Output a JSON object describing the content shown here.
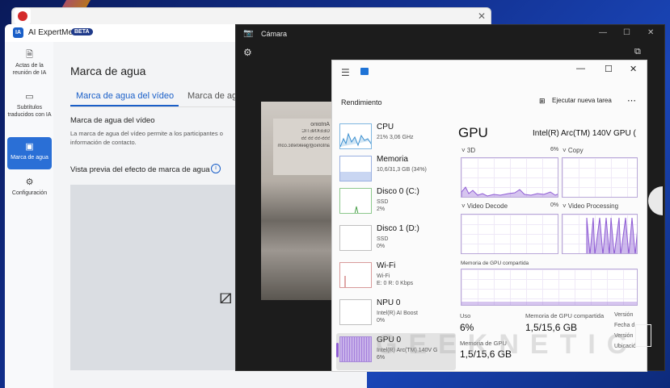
{
  "ai_expertmeet": {
    "app_name": "AI ExpertMeet",
    "badge": "BETA",
    "sidebar": [
      {
        "label": "Actas de la reunión de IA"
      },
      {
        "label": "Subtítulos traducidos con IA"
      },
      {
        "label": "Marca de agua"
      },
      {
        "label": "Configuración"
      }
    ],
    "page_title": "Marca de agua",
    "tabs": [
      "Marca de agua del vídeo",
      "Marca de ag"
    ],
    "section_title": "Marca de agua del vídeo",
    "section_desc": "La marca de agua del vídeo permite a los participantes o información de contacto.",
    "preview_title": "Vista previa del efecto de marca de agua",
    "info_icon": "i"
  },
  "camera": {
    "title": "Cámara",
    "card_lines": [
      "Antoino",
      "GEEKNETIC",
      "555-55 55 55",
      "antonio@geeknetic.com"
    ]
  },
  "taskmgr": {
    "section": "Rendimiento",
    "run_task": "Ejecutar nueva tarea",
    "items": [
      {
        "name": "CPU",
        "sub": "21%  3,06 GHz"
      },
      {
        "name": "Memoria",
        "sub": "10,6/31,3 GB (34%)"
      },
      {
        "name": "Disco 0 (C:)",
        "sub": "SSD\n2%"
      },
      {
        "name": "Disco 1 (D:)",
        "sub": "SSD\n0%"
      },
      {
        "name": "Wi-Fi",
        "sub": "Wi-Fi\nE: 0 R: 0 Kbps"
      },
      {
        "name": "NPU 0",
        "sub": "Intel(R) AI Boost\n0%"
      },
      {
        "name": "GPU 0",
        "sub": "Intel(R) Arc(TM) 140V G\n6%"
      }
    ],
    "gpu": {
      "heading": "GPU",
      "name": "Intel(R) Arc(TM) 140V GPU (",
      "engines": [
        {
          "label": "3D",
          "pct": "6%"
        },
        {
          "label": "Copy",
          "pct": ""
        },
        {
          "label": "Video Decode",
          "pct": "0%"
        },
        {
          "label": "Video Processing",
          "pct": ""
        }
      ],
      "shared_label": "Memoria de GPU compartida",
      "stats": [
        {
          "label": "Uso",
          "value": "6%"
        },
        {
          "label": "Memoria de GPU compartida",
          "value": "1,5/15,6 GB"
        },
        {
          "label": "Memoria de GPU",
          "value": "1,5/15,6 GB"
        }
      ],
      "info_labels": [
        "Versión",
        "Fecha d",
        "Versión",
        "Ubicació"
      ]
    }
  },
  "watermark_text": "GEEKNETIC",
  "colors": {
    "accent": "#1a5fc8",
    "gpu_purple": "#8e5bd4",
    "active_nav": "#2a6fd6"
  }
}
